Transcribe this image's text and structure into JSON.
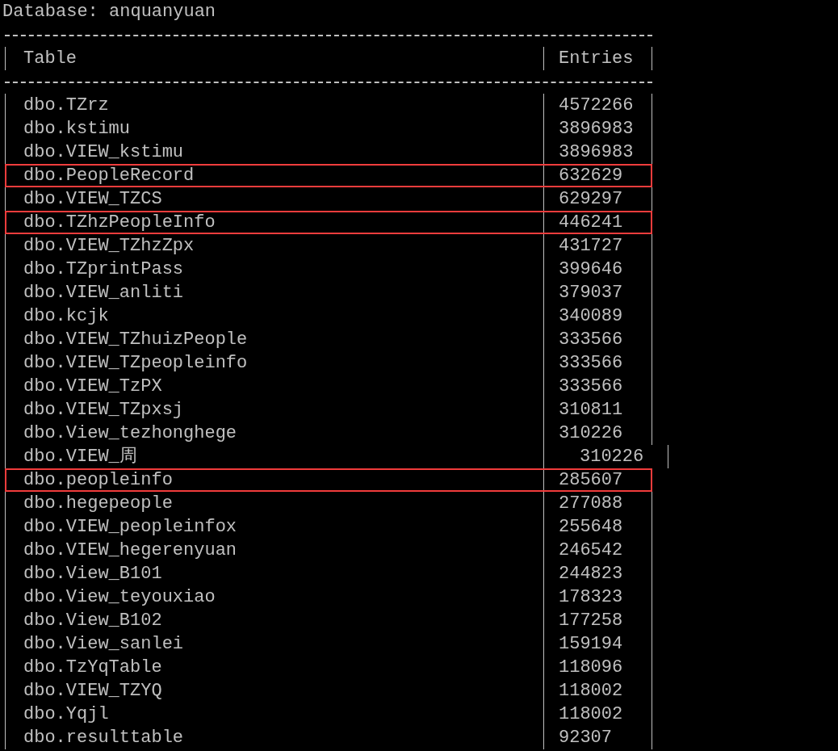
{
  "title": "Database: anquanyuan",
  "table": {
    "columns": [
      "Table",
      "Entries"
    ],
    "rows": [
      {
        "table": "dbo.TZrz",
        "entries": "4572266",
        "highlighted": false,
        "misaligned": false
      },
      {
        "table": "dbo.kstimu",
        "entries": "3896983",
        "highlighted": false,
        "misaligned": false
      },
      {
        "table": "dbo.VIEW_kstimu",
        "entries": "3896983",
        "highlighted": false,
        "misaligned": false
      },
      {
        "table": "dbo.PeopleRecord",
        "entries": "632629",
        "highlighted": true,
        "misaligned": false
      },
      {
        "table": "dbo.VIEW_TZCS",
        "entries": "629297",
        "highlighted": false,
        "misaligned": false
      },
      {
        "table": "dbo.TZhzPeopleInfo",
        "entries": "446241",
        "highlighted": true,
        "misaligned": false
      },
      {
        "table": "dbo.VIEW_TZhzZpx",
        "entries": "431727",
        "highlighted": false,
        "misaligned": false
      },
      {
        "table": "dbo.TZprintPass",
        "entries": "399646",
        "highlighted": false,
        "misaligned": false
      },
      {
        "table": "dbo.VIEW_anliti",
        "entries": "379037",
        "highlighted": false,
        "misaligned": false
      },
      {
        "table": "dbo.kcjk",
        "entries": "340089",
        "highlighted": false,
        "misaligned": false
      },
      {
        "table": "dbo.VIEW_TZhuizPeople",
        "entries": "333566",
        "highlighted": false,
        "misaligned": false
      },
      {
        "table": "dbo.VIEW_TZpeopleinfo",
        "entries": "333566",
        "highlighted": false,
        "misaligned": false
      },
      {
        "table": "dbo.VIEW_TzPX",
        "entries": "333566",
        "highlighted": false,
        "misaligned": false
      },
      {
        "table": "dbo.VIEW_TZpxsj",
        "entries": "310811",
        "highlighted": false,
        "misaligned": false
      },
      {
        "table": "dbo.View_tezhonghege",
        "entries": "310226",
        "highlighted": false,
        "misaligned": false
      },
      {
        "table": "dbo.VIEW_周",
        "entries": "310226",
        "highlighted": false,
        "misaligned": true
      },
      {
        "table": "dbo.peopleinfo",
        "entries": "285607",
        "highlighted": true,
        "misaligned": false
      },
      {
        "table": "dbo.hegepeople",
        "entries": "277088",
        "highlighted": false,
        "misaligned": false
      },
      {
        "table": "dbo.VIEW_peopleinfox",
        "entries": "255648",
        "highlighted": false,
        "misaligned": false
      },
      {
        "table": "dbo.VIEW_hegerenyuan",
        "entries": "246542",
        "highlighted": false,
        "misaligned": false
      },
      {
        "table": "dbo.View_B101",
        "entries": "244823",
        "highlighted": false,
        "misaligned": false
      },
      {
        "table": "dbo.View_teyouxiao",
        "entries": "178323",
        "highlighted": false,
        "misaligned": false
      },
      {
        "table": "dbo.View_B102",
        "entries": "177258",
        "highlighted": false,
        "misaligned": false
      },
      {
        "table": "dbo.View_sanlei",
        "entries": "159194",
        "highlighted": false,
        "misaligned": false
      },
      {
        "table": "dbo.TzYqTable",
        "entries": "118096",
        "highlighted": false,
        "misaligned": false
      },
      {
        "table": "dbo.VIEW_TZYQ",
        "entries": "118002",
        "highlighted": false,
        "misaligned": false
      },
      {
        "table": "dbo.Yqjl",
        "entries": "118002",
        "highlighted": false,
        "misaligned": false
      },
      {
        "table": "dbo.resulttable",
        "entries": "92307",
        "highlighted": false,
        "misaligned": false
      }
    ]
  }
}
